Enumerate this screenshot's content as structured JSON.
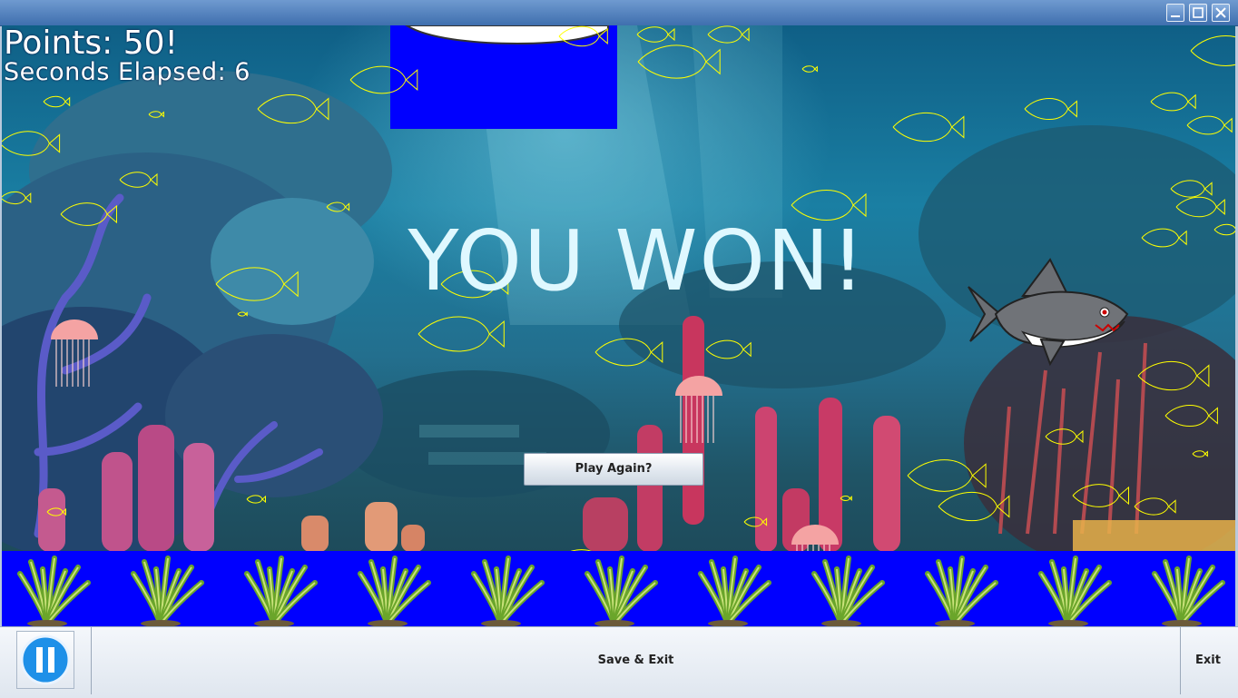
{
  "window": {
    "controls": [
      "minimize-icon",
      "maximize-icon",
      "close-icon"
    ]
  },
  "hud": {
    "points_text": "Points: 50!",
    "seconds_text": "Seconds Elapsed: 6"
  },
  "banner": {
    "message": "YOU WON!"
  },
  "play_again": {
    "label": "Play Again?"
  },
  "bottom_bar": {
    "pause_icon": "pause-icon",
    "save_label": "Save & Exit",
    "exit_label": "Exit"
  },
  "colors": {
    "fish_outline": "#ffff00",
    "floor_blue": "#0000ff",
    "jellyfish": "#f4a3a3",
    "banner_text": "#dff8ff",
    "pause_blue": "#1e90e8"
  }
}
